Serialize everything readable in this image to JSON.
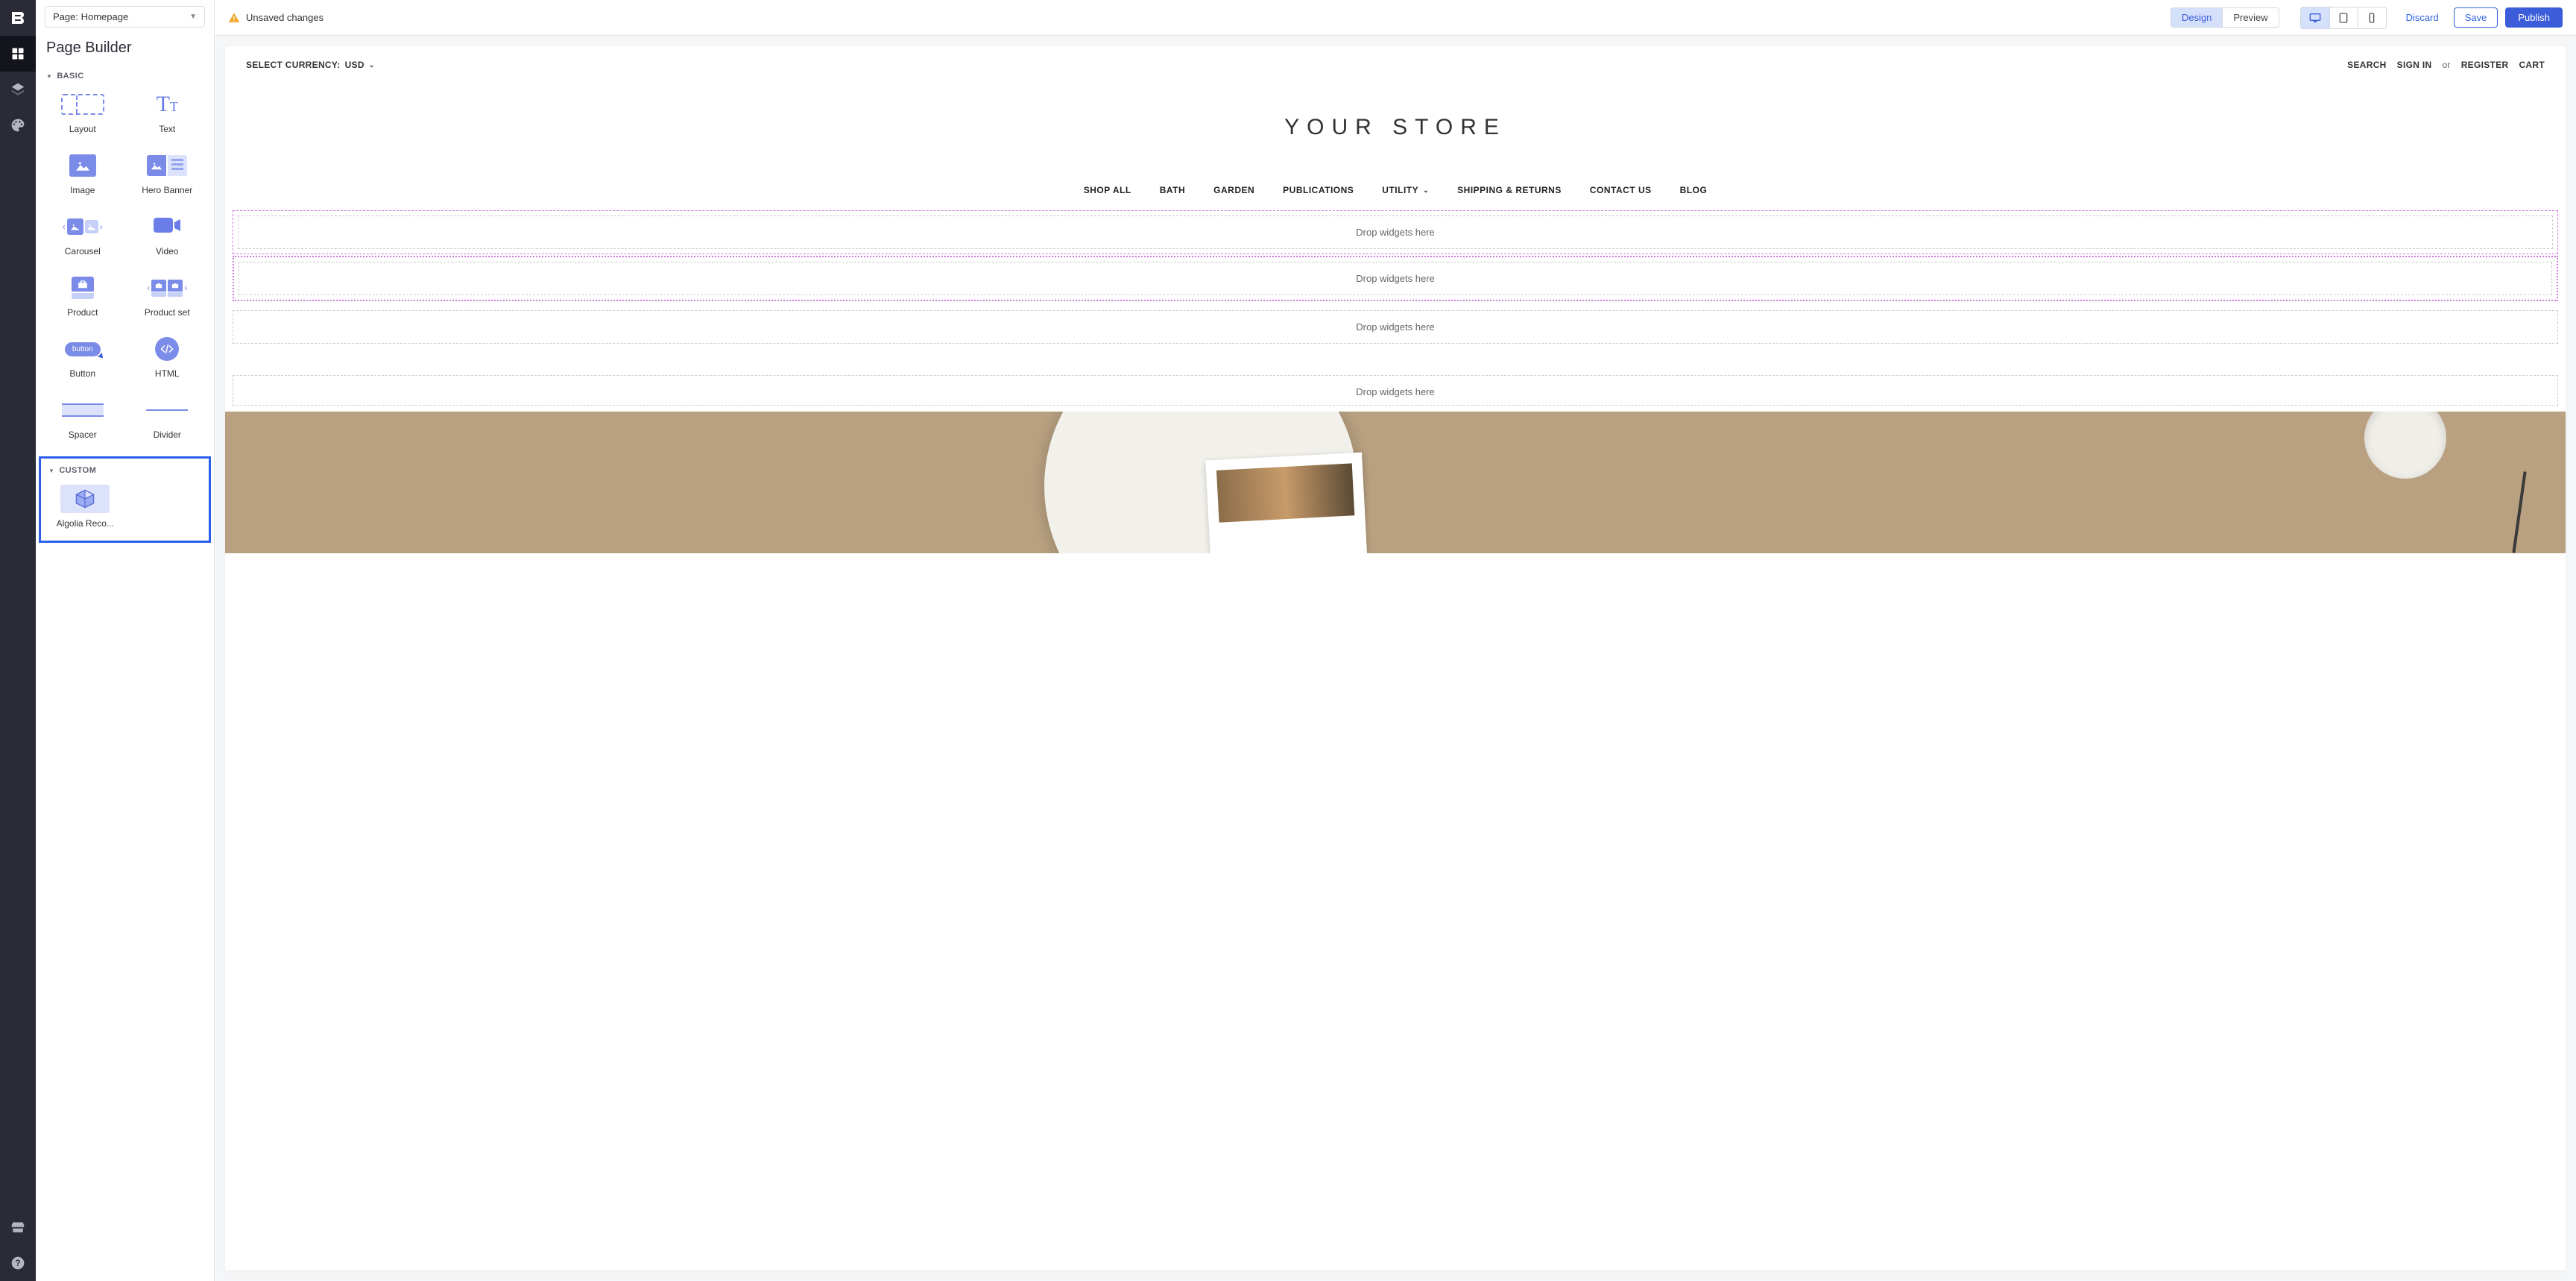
{
  "iconRail": {
    "logo": "B"
  },
  "sidebar": {
    "pageSelector": "Page: Homepage",
    "title": "Page Builder",
    "sections": {
      "basic": {
        "header": "BASIC",
        "widgets": [
          {
            "label": "Layout"
          },
          {
            "label": "Text"
          },
          {
            "label": "Image"
          },
          {
            "label": "Hero Banner"
          },
          {
            "label": "Carousel"
          },
          {
            "label": "Video"
          },
          {
            "label": "Product"
          },
          {
            "label": "Product set"
          },
          {
            "label": "Button",
            "pill": "button"
          },
          {
            "label": "HTML"
          },
          {
            "label": "Spacer"
          },
          {
            "label": "Divider"
          }
        ]
      },
      "custom": {
        "header": "CUSTOM",
        "widgets": [
          {
            "label": "Algolia Reco..."
          }
        ]
      }
    }
  },
  "topbar": {
    "unsaved": "Unsaved changes",
    "modeToggle": {
      "design": "Design",
      "preview": "Preview"
    },
    "actions": {
      "discard": "Discard",
      "save": "Save",
      "publish": "Publish"
    }
  },
  "canvas": {
    "currency": {
      "label": "SELECT CURRENCY:",
      "value": "USD"
    },
    "topRight": {
      "search": "SEARCH",
      "signIn": "SIGN IN",
      "or": "or",
      "register": "REGISTER",
      "cart": "CART"
    },
    "storeTitle": "YOUR STORE",
    "nav": [
      {
        "label": "SHOP ALL"
      },
      {
        "label": "BATH"
      },
      {
        "label": "GARDEN"
      },
      {
        "label": "PUBLICATIONS"
      },
      {
        "label": "UTILITY",
        "hasChevron": true
      },
      {
        "label": "SHIPPING & RETURNS"
      },
      {
        "label": "CONTACT US"
      },
      {
        "label": "BLOG"
      }
    ],
    "dropText": "Drop widgets here"
  }
}
